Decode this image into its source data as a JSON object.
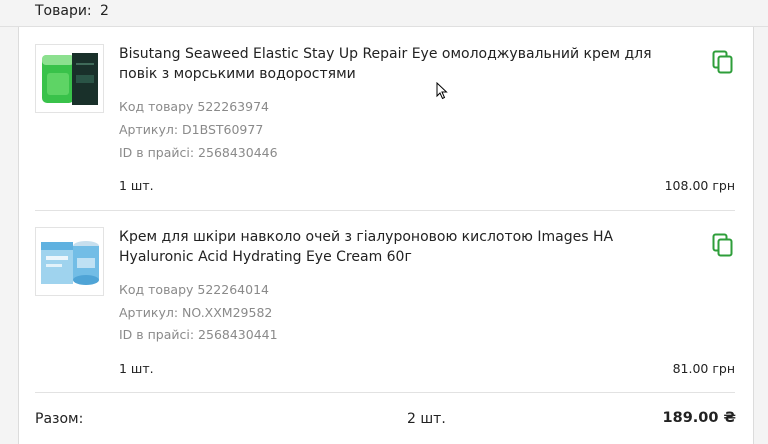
{
  "header": {
    "label": "Товари:",
    "count": "2"
  },
  "items": [
    {
      "title": "Bisutang Seaweed Elastic Stay Up Repair Eye омолоджувальний крем для повік з морськими водоростями",
      "code": "Код товару 522263974",
      "article": "Артикул: D1BST60977",
      "price_id": "ID в прайсі: 2568430446",
      "quantity": "1 шт.",
      "price": "108.00 грн",
      "icon": "copy-icon"
    },
    {
      "title": "Крем для шкіри навколо очей з гіалуроновою кислотою Images HA Hyaluronic Acid Hydrating Eye Cream 60г",
      "code": "Код товару 522264014",
      "article": "Артикул: NO.XXM29582",
      "price_id": "ID в прайсі: 2568430441",
      "quantity": "1 шт.",
      "price": "81.00 грн",
      "icon": "copy-icon"
    }
  ],
  "totals": {
    "label": "Разом:",
    "quantity": "2 шт.",
    "sum": "189.00 ₴"
  },
  "colors": {
    "accent_green": "#2e9e3a",
    "muted_text": "#8a8a8a"
  }
}
